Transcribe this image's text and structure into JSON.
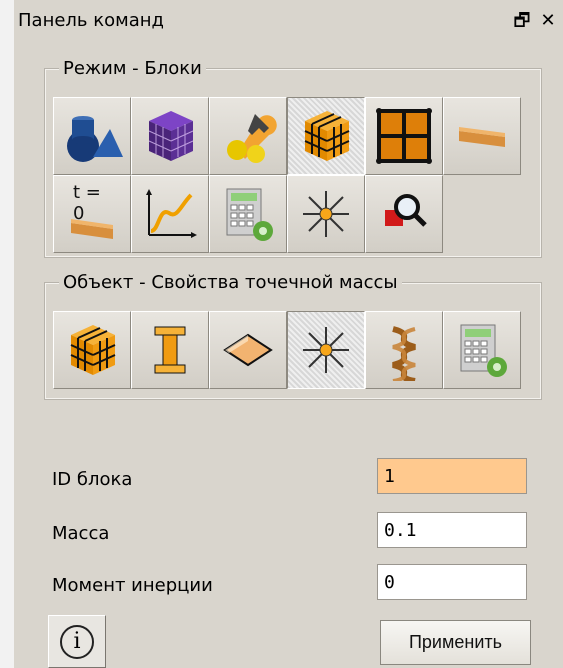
{
  "window": {
    "title": "Панель команд",
    "controls": {
      "restore_icon": "restore-icon",
      "close_icon": "close-icon",
      "restore_glyph": "🗗",
      "close_glyph": "✕"
    }
  },
  "mode_group": {
    "label": "Режим - Блоки",
    "buttons": [
      {
        "name": "primitives",
        "icon": "shapes-icon"
      },
      {
        "name": "mesh-cube",
        "icon": "mesh-cube-icon"
      },
      {
        "name": "settings-tools",
        "icon": "wrench-icon"
      },
      {
        "name": "block-cube",
        "icon": "block-cube-icon",
        "active": true
      },
      {
        "name": "grid-blocks",
        "icon": "grid-blocks-icon"
      },
      {
        "name": "beam",
        "icon": "beam-icon"
      },
      {
        "name": "time-zero",
        "icon": "time-zero-icon",
        "text": "t = 0"
      },
      {
        "name": "graph",
        "icon": "graph-icon"
      },
      {
        "name": "calculator",
        "icon": "calculator-icon"
      },
      {
        "name": "point-mass",
        "icon": "point-mass-icon"
      },
      {
        "name": "search-zoom",
        "icon": "search-icon"
      }
    ]
  },
  "object_group": {
    "label": "Объект - Свойства точечной массы",
    "buttons": [
      {
        "name": "block-cube",
        "icon": "block-cube-icon"
      },
      {
        "name": "i-beam",
        "icon": "i-beam-icon"
      },
      {
        "name": "plate",
        "icon": "plate-icon"
      },
      {
        "name": "point-mass",
        "icon": "point-mass-icon",
        "active": true
      },
      {
        "name": "spring",
        "icon": "spring-icon"
      },
      {
        "name": "calculator",
        "icon": "calculator-icon"
      }
    ]
  },
  "fields": {
    "id_label": "ID блока",
    "id_value": "1",
    "mass_label": "Масса",
    "mass_value": "0.1",
    "inertia_label": "Момент инерции",
    "inertia_value": "0"
  },
  "actions": {
    "info_glyph": "i",
    "apply_label": "Применить"
  },
  "colors": {
    "panel_bg": "#d9d5cd",
    "highlight_field": "#ffc98e",
    "accent_orange": "#f7a61a"
  }
}
